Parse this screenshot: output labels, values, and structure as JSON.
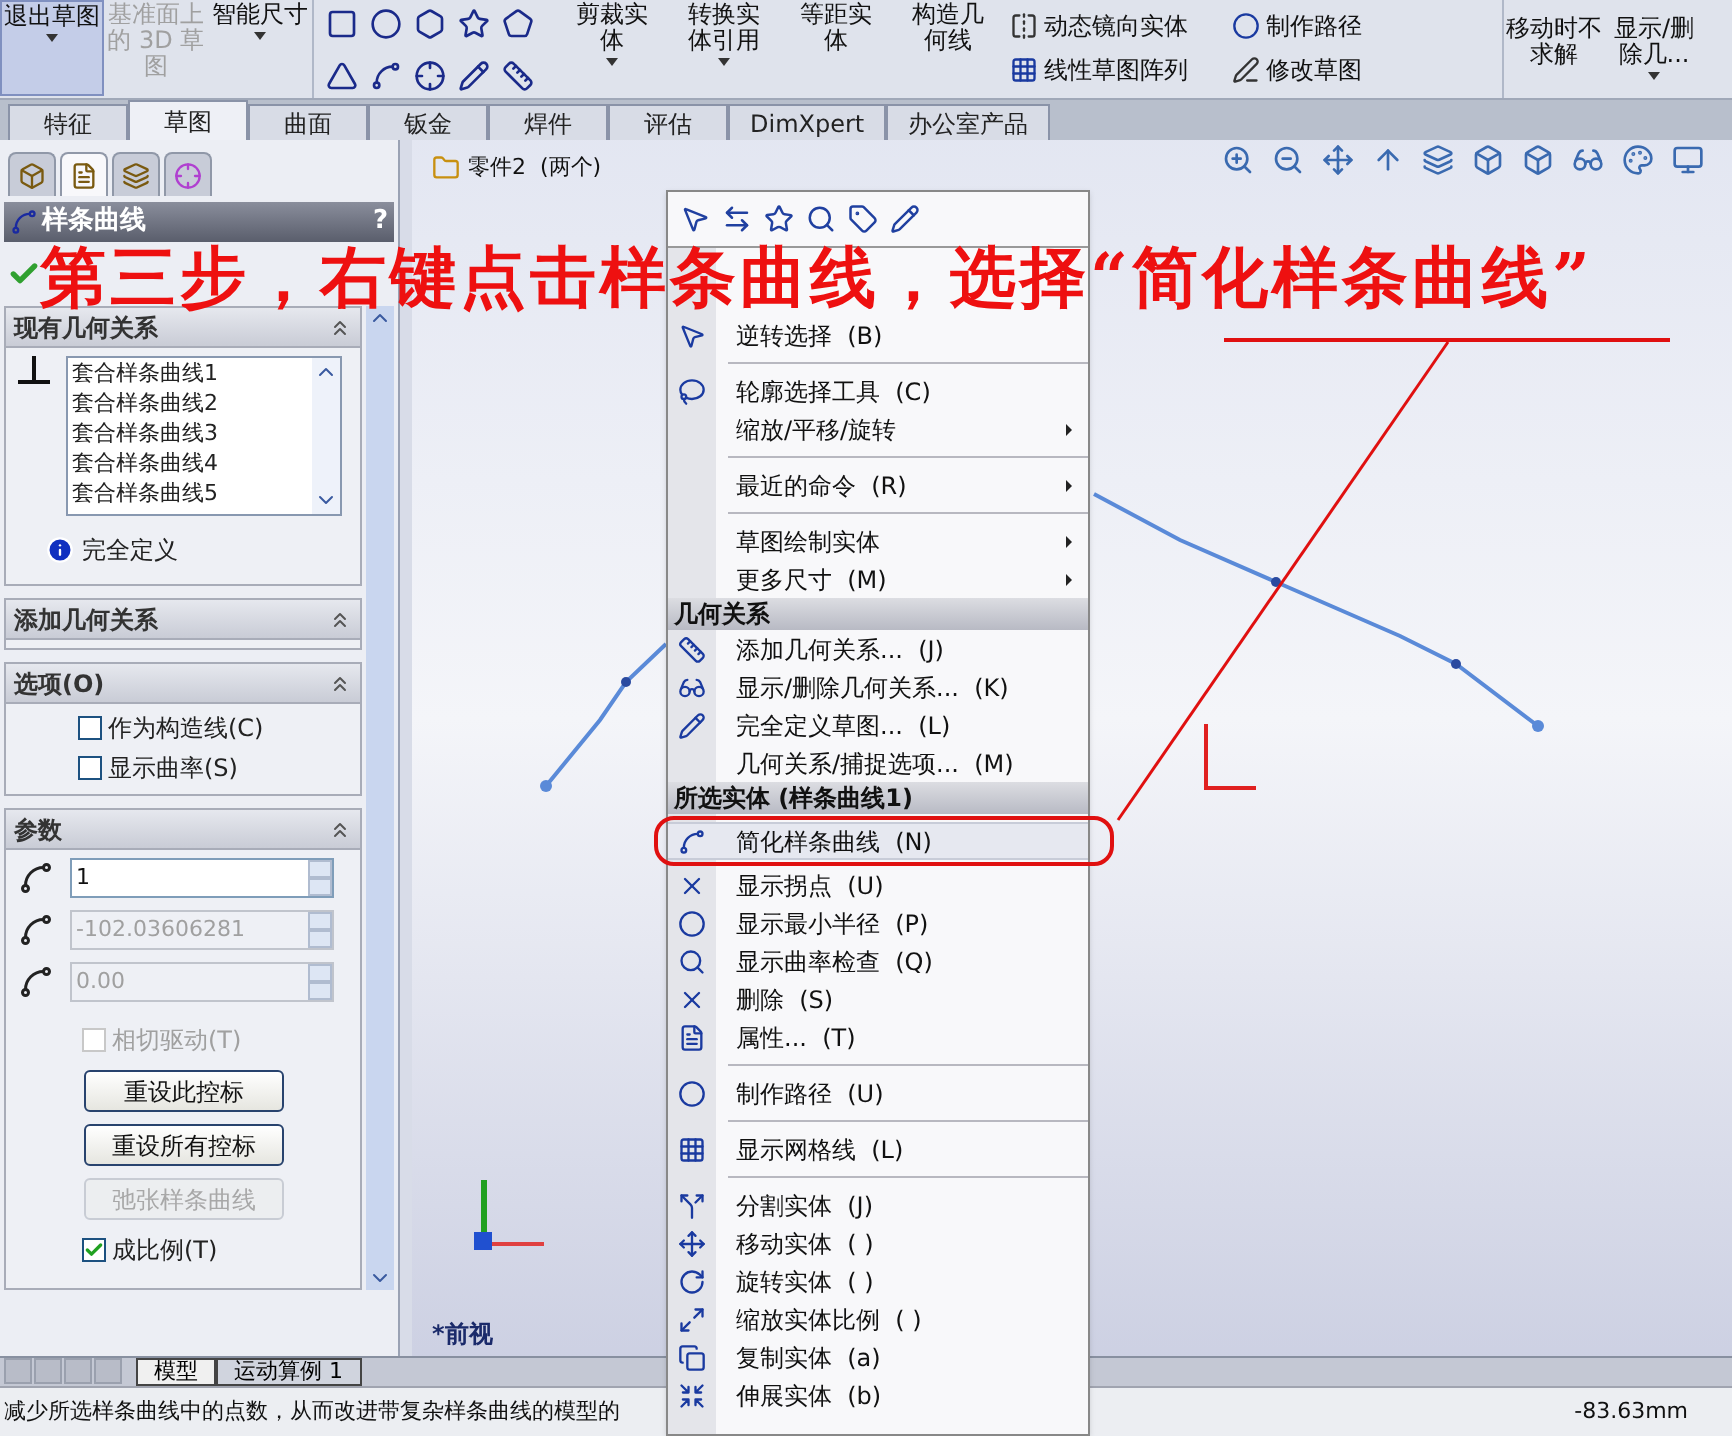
{
  "toolbar": {
    "large_buttons": [
      {
        "label": "退出草图",
        "selected": true,
        "disabled": false,
        "caret": true
      },
      {
        "label": "基准面上的 3D 草图",
        "selected": false,
        "disabled": true,
        "caret": false
      },
      {
        "label": "智能尺寸",
        "selected": false,
        "disabled": false,
        "caret": true
      }
    ],
    "tool_buttons": [
      {
        "label": "剪裁实体",
        "caret": true
      },
      {
        "label": "转换实体引用",
        "caret": true
      },
      {
        "label": "等距实体",
        "caret": false
      },
      {
        "label": "构造几何线",
        "caret": false
      }
    ],
    "small_buttons": [
      {
        "label": "动态镜向实体"
      },
      {
        "label": "线性草图阵列"
      },
      {
        "label": "制作路径"
      },
      {
        "label": "修改草图"
      }
    ],
    "end_buttons": [
      {
        "label": "移动时不求解",
        "caret": false
      },
      {
        "label": "显示/删除几...",
        "caret": true
      }
    ]
  },
  "command_tabs": [
    {
      "label": "特征",
      "selected": false
    },
    {
      "label": "草图",
      "selected": true
    },
    {
      "label": "曲面",
      "selected": false
    },
    {
      "label": "钣金",
      "selected": false
    },
    {
      "label": "焊件",
      "selected": false
    },
    {
      "label": "评估",
      "selected": false
    },
    {
      "label": "DimXpert",
      "selected": false
    },
    {
      "label": "办公室产品",
      "selected": false
    }
  ],
  "property_panel": {
    "tabs": [
      {
        "selected": false
      },
      {
        "selected": true
      },
      {
        "selected": false
      },
      {
        "selected": false
      }
    ],
    "title": "样条曲线",
    "help": "?",
    "relations": {
      "title": "现有几何关系",
      "items": [
        "套合样条曲线1",
        "套合样条曲线2",
        "套合样条曲线3",
        "套合样条曲线4",
        "套合样条曲线5"
      ],
      "status": "完全定义"
    },
    "add_relations": {
      "title": "添加几何关系"
    },
    "options": {
      "title": "选项(O)",
      "checkboxes": [
        {
          "label": "作为构造线(C)",
          "checked": false
        },
        {
          "label": "显示曲率(S)",
          "checked": false
        }
      ]
    },
    "parameters": {
      "title": "参数",
      "fields": [
        {
          "value": "1",
          "disabled": false
        },
        {
          "value": "-102.03606281",
          "disabled": true
        },
        {
          "value": "0.00",
          "disabled": true
        }
      ],
      "tangent_checkbox": {
        "label": "相切驱动(T)",
        "checked": false,
        "disabled": true
      },
      "buttons": [
        {
          "label": "重设此控标",
          "disabled": false
        },
        {
          "label": "重设所有控标",
          "disabled": false
        },
        {
          "label": "弛张样条曲线",
          "disabled": true
        }
      ],
      "scale_checkbox": {
        "label": "成比例(T)",
        "checked": true,
        "disabled": false
      }
    }
  },
  "graphics": {
    "tree_label": "零件2  (两个)",
    "view_label": "*前视"
  },
  "context_menu": {
    "items": [
      {
        "kind": "item",
        "label": "逆转选择",
        "shortcut": "(B)",
        "submenu": false,
        "highlighted": false
      },
      {
        "kind": "separator"
      },
      {
        "kind": "item",
        "label": "轮廓选择工具",
        "shortcut": "(C)",
        "submenu": false,
        "highlighted": false
      },
      {
        "kind": "item",
        "label": "缩放/平移/旋转",
        "submenu": true,
        "highlighted": false
      },
      {
        "kind": "separator"
      },
      {
        "kind": "item",
        "label": "最近的命令",
        "shortcut": "(R)",
        "submenu": true,
        "highlighted": false
      },
      {
        "kind": "separator"
      },
      {
        "kind": "item",
        "label": "草图绘制实体",
        "submenu": true,
        "highlighted": false
      },
      {
        "kind": "item",
        "label": "更多尺寸",
        "shortcut": "(M)",
        "submenu": true,
        "highlighted": false
      },
      {
        "kind": "header",
        "label": "几何关系"
      },
      {
        "kind": "item",
        "label": "添加几何关系...",
        "shortcut": "(J)",
        "submenu": false,
        "highlighted": false
      },
      {
        "kind": "item",
        "label": "显示/删除几何关系...",
        "shortcut": "(K)",
        "submenu": false,
        "highlighted": false
      },
      {
        "kind": "item",
        "label": "完全定义草图...",
        "shortcut": "(L)",
        "submenu": false,
        "highlighted": false
      },
      {
        "kind": "item",
        "label": "几何关系/捕捉选项...",
        "shortcut": "(M)",
        "submenu": false,
        "highlighted": false
      },
      {
        "kind": "header",
        "label": "所选实体 (样条曲线1)"
      },
      {
        "kind": "item",
        "label": "简化样条曲线",
        "shortcut": "(N)",
        "submenu": false,
        "highlighted": true
      },
      {
        "kind": "item",
        "label": "显示拐点",
        "shortcut": "(U)",
        "submenu": false,
        "highlighted": false
      },
      {
        "kind": "item",
        "label": "显示最小半径",
        "shortcut": "(P)",
        "submenu": false,
        "highlighted": false
      },
      {
        "kind": "item",
        "label": "显示曲率检查",
        "shortcut": "(Q)",
        "submenu": false,
        "highlighted": false
      },
      {
        "kind": "item",
        "label": "删除",
        "shortcut": "(S)",
        "submenu": false,
        "highlighted": false
      },
      {
        "kind": "item",
        "label": "属性...",
        "shortcut": "(T)",
        "submenu": false,
        "highlighted": false
      },
      {
        "kind": "separator"
      },
      {
        "kind": "item",
        "label": "制作路径",
        "shortcut": "(U)",
        "submenu": false,
        "highlighted": false
      },
      {
        "kind": "separator"
      },
      {
        "kind": "item",
        "label": "显示网格线",
        "shortcut": "(L)",
        "submenu": false,
        "highlighted": false
      },
      {
        "kind": "separator"
      },
      {
        "kind": "item",
        "label": "分割实体",
        "shortcut": "(J)",
        "submenu": false,
        "highlighted": false
      },
      {
        "kind": "item",
        "label": "移动实体",
        "shortcut": "( )",
        "submenu": false,
        "highlighted": false
      },
      {
        "kind": "item",
        "label": "旋转实体",
        "shortcut": "( )",
        "submenu": false,
        "highlighted": false
      },
      {
        "kind": "item",
        "label": "缩放实体比例",
        "shortcut": "( )",
        "submenu": false,
        "highlighted": false
      },
      {
        "kind": "item",
        "label": "复制实体",
        "shortcut": "(a)",
        "submenu": false,
        "highlighted": false
      },
      {
        "kind": "item",
        "label": "伸展实体",
        "shortcut": "(b)",
        "submenu": false,
        "highlighted": false
      }
    ]
  },
  "bottom_tabs": [
    {
      "label": "模型",
      "selected": true
    },
    {
      "label": "运动算例 1",
      "selected": false
    }
  ],
  "status_bar": {
    "message": "减少所选样条曲线中的点数，从而改进带复杂样条曲线的模型的",
    "coordinate": "-83.63mm"
  },
  "annotation": {
    "text": "第三步，右键点击样条曲线，选择“简化样条曲线”"
  }
}
